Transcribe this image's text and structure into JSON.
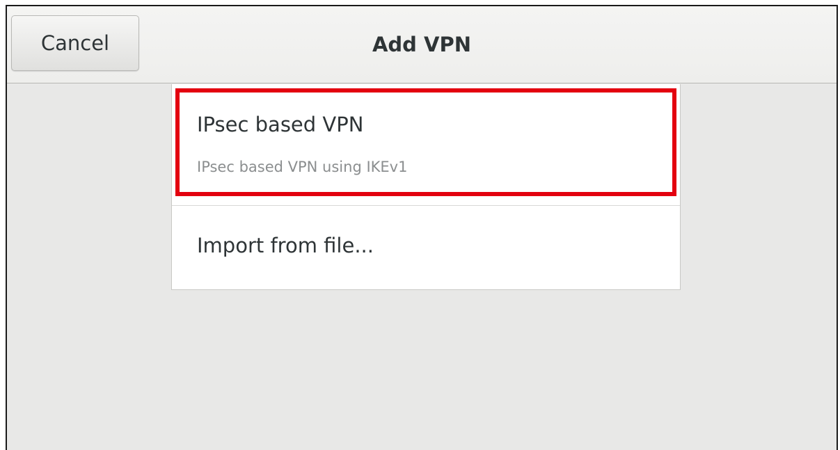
{
  "header": {
    "title": "Add VPN",
    "cancel_label": "Cancel"
  },
  "vpn_types": [
    {
      "title": "IPsec based VPN",
      "subtitle": "IPsec based VPN using IKEv1",
      "highlighted": true
    },
    {
      "title": "Import from file..."
    }
  ],
  "colors": {
    "highlight_border": "#e3000f",
    "background": "#e8e8e7",
    "list_background": "#ffffff"
  }
}
